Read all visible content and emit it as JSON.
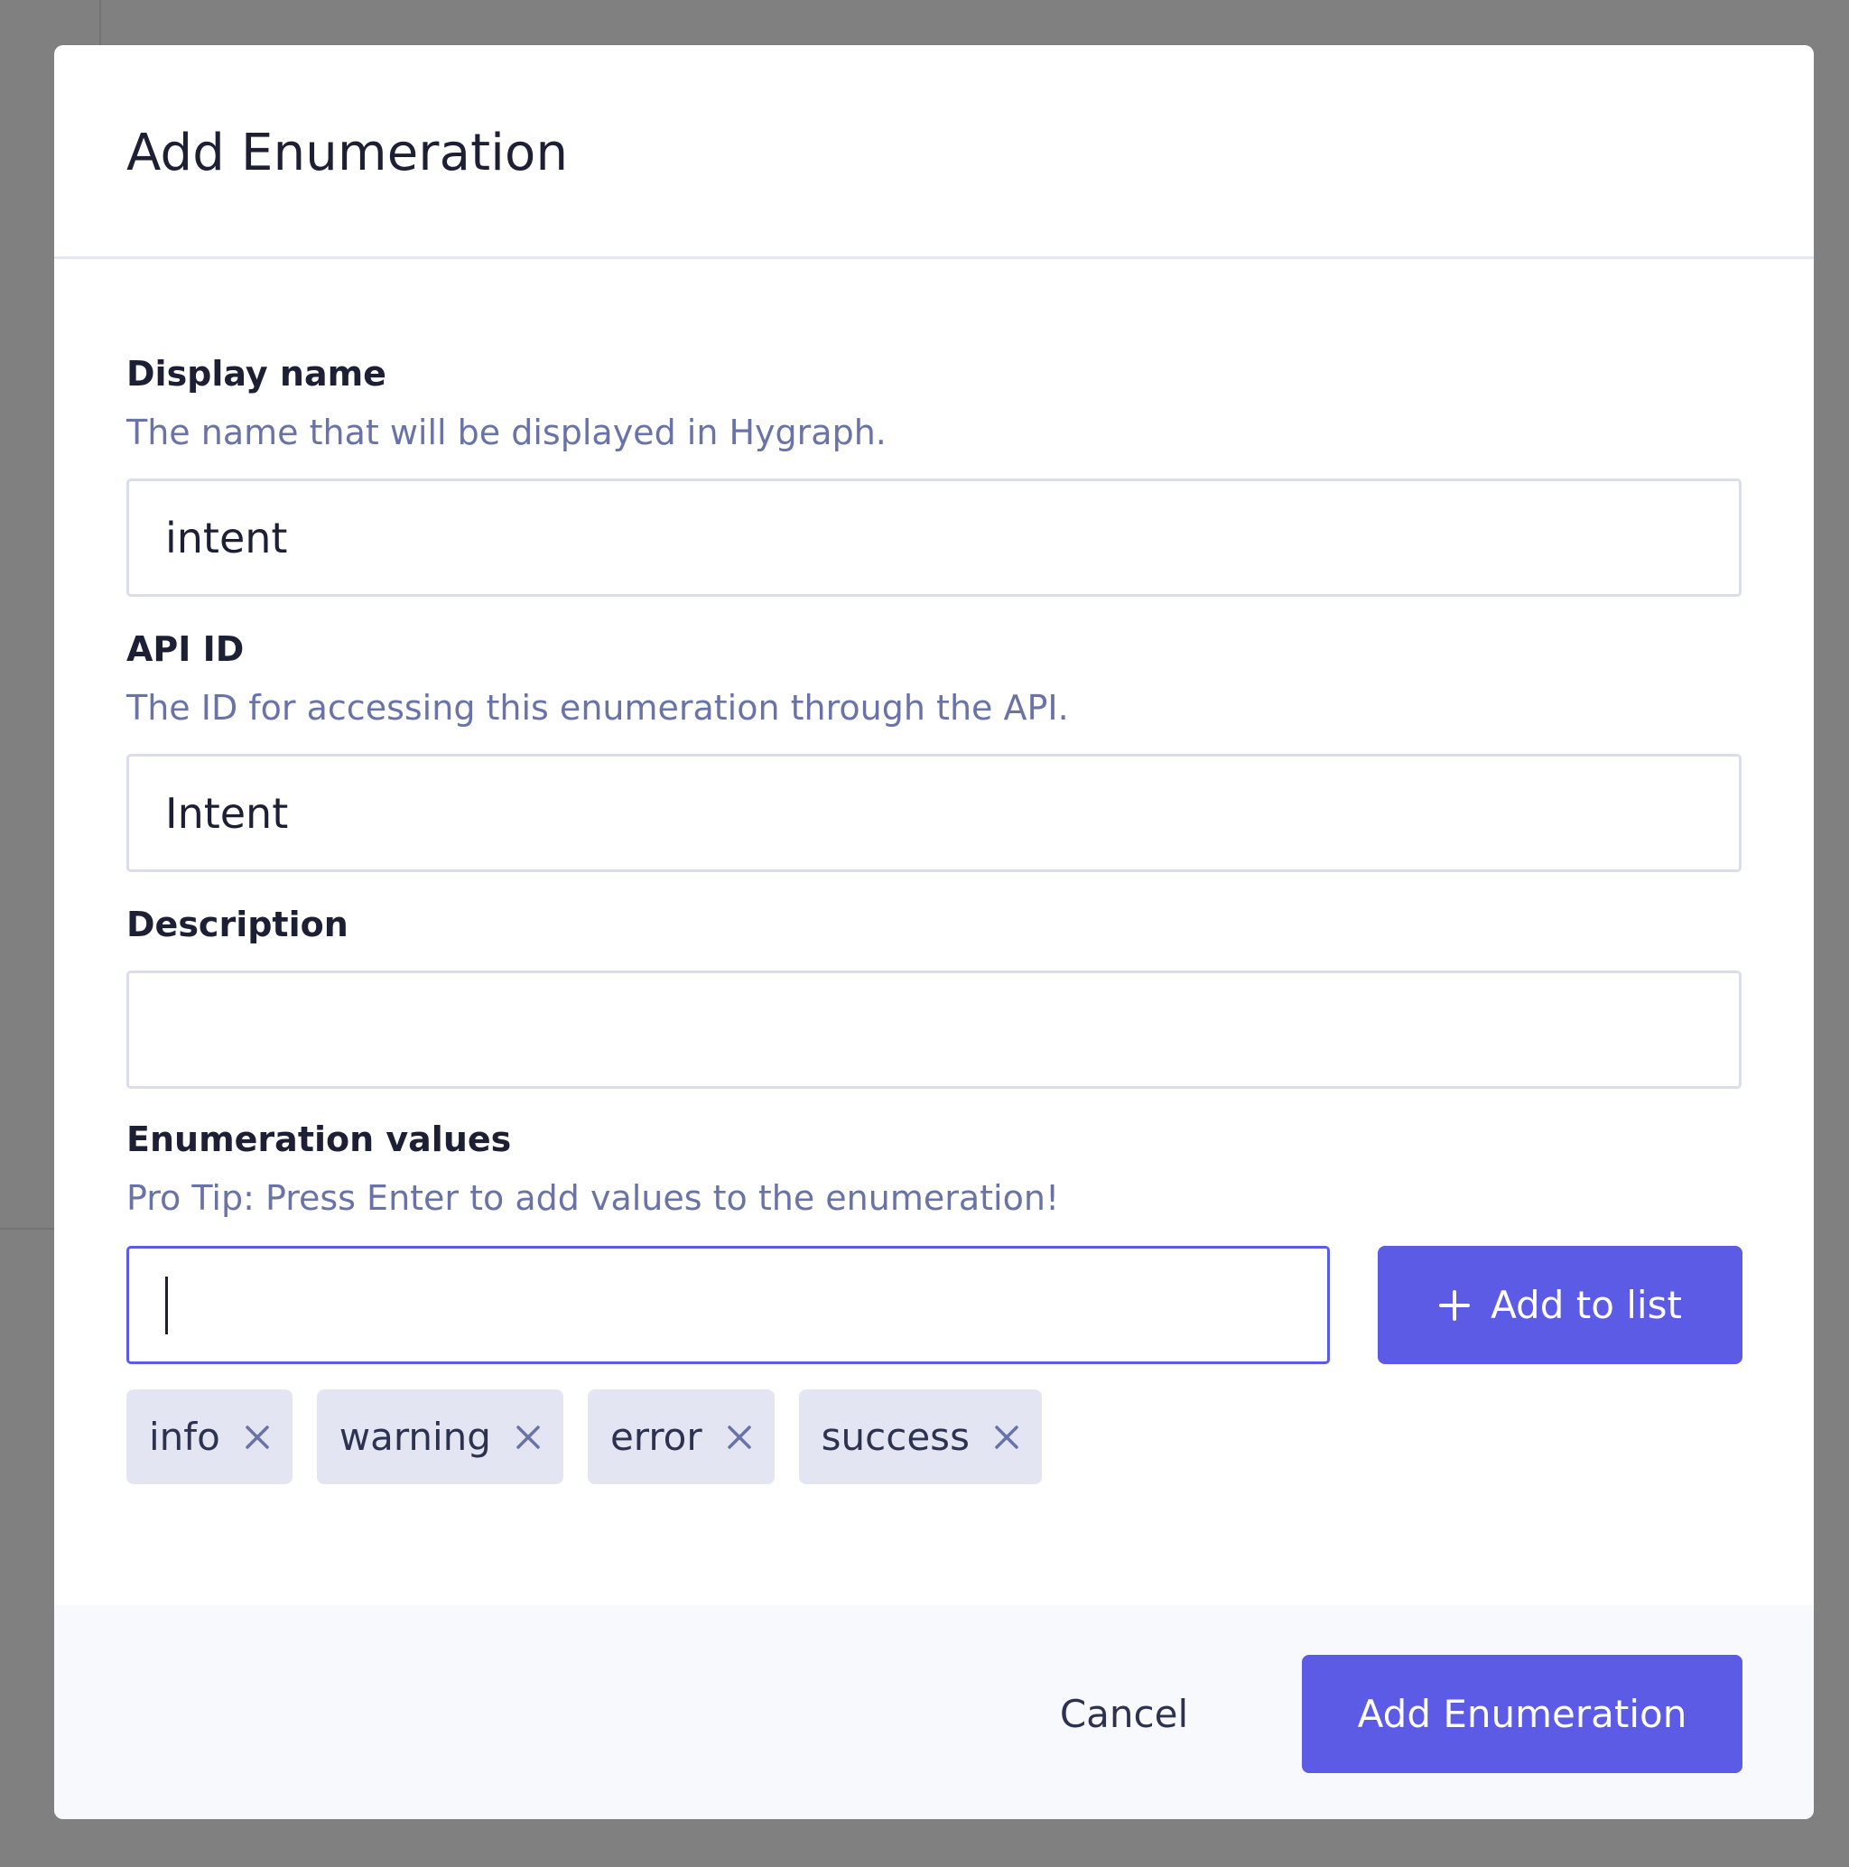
{
  "dialog": {
    "title": "Add Enumeration"
  },
  "fields": {
    "display_name": {
      "label": "Display name",
      "help": "The name that will be displayed in Hygraph.",
      "value": "intent"
    },
    "api_id": {
      "label": "API ID",
      "help": "The ID for accessing this enumeration through the API.",
      "value": "Intent"
    },
    "description": {
      "label": "Description",
      "value": ""
    },
    "enum_values": {
      "label": "Enumeration values",
      "help": "Pro Tip: Press Enter to add values to the enumeration!",
      "input_value": "",
      "add_button_label": "Add to list",
      "add_button_icon": "plus-icon",
      "values": [
        "info",
        "warning",
        "error",
        "success"
      ],
      "remove_icon": "close-icon"
    }
  },
  "footer": {
    "cancel_label": "Cancel",
    "submit_label": "Add Enumeration"
  },
  "colors": {
    "primary": "#5b5be6",
    "help_text": "#6a73a8",
    "tag_bg": "#e3e6f2",
    "overlay": "#808080"
  }
}
